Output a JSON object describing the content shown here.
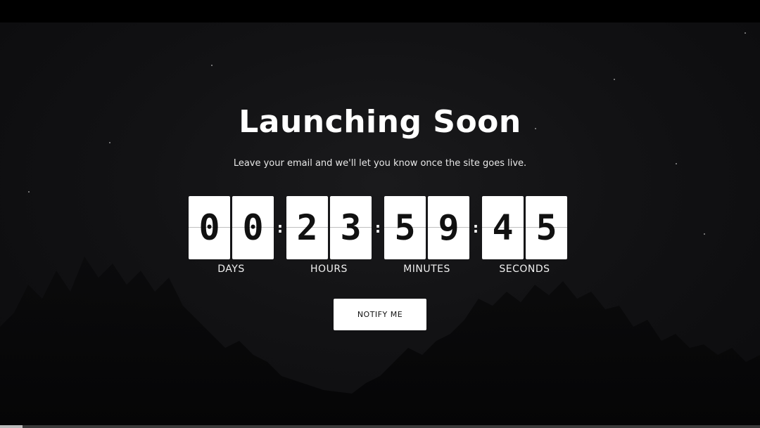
{
  "hero": {
    "title": "Launching Soon",
    "subtitle": "Leave your email and we'll let you know once the site goes live."
  },
  "countdown": {
    "days": {
      "digits": [
        "0",
        "0"
      ],
      "label": "DAYS"
    },
    "hours": {
      "digits": [
        "2",
        "3"
      ],
      "label": "HOURS"
    },
    "minutes": {
      "digits": [
        "5",
        "9"
      ],
      "label": "MINUTES"
    },
    "seconds": {
      "digits": [
        "4",
        "5"
      ],
      "label": "SECONDS"
    },
    "separator": ":"
  },
  "cta": {
    "label": "NOTIFY ME"
  },
  "video_progress": {
    "fraction": 0.03
  },
  "colors": {
    "background": "#121214",
    "card": "#ffffff",
    "text": "#ffffff"
  }
}
